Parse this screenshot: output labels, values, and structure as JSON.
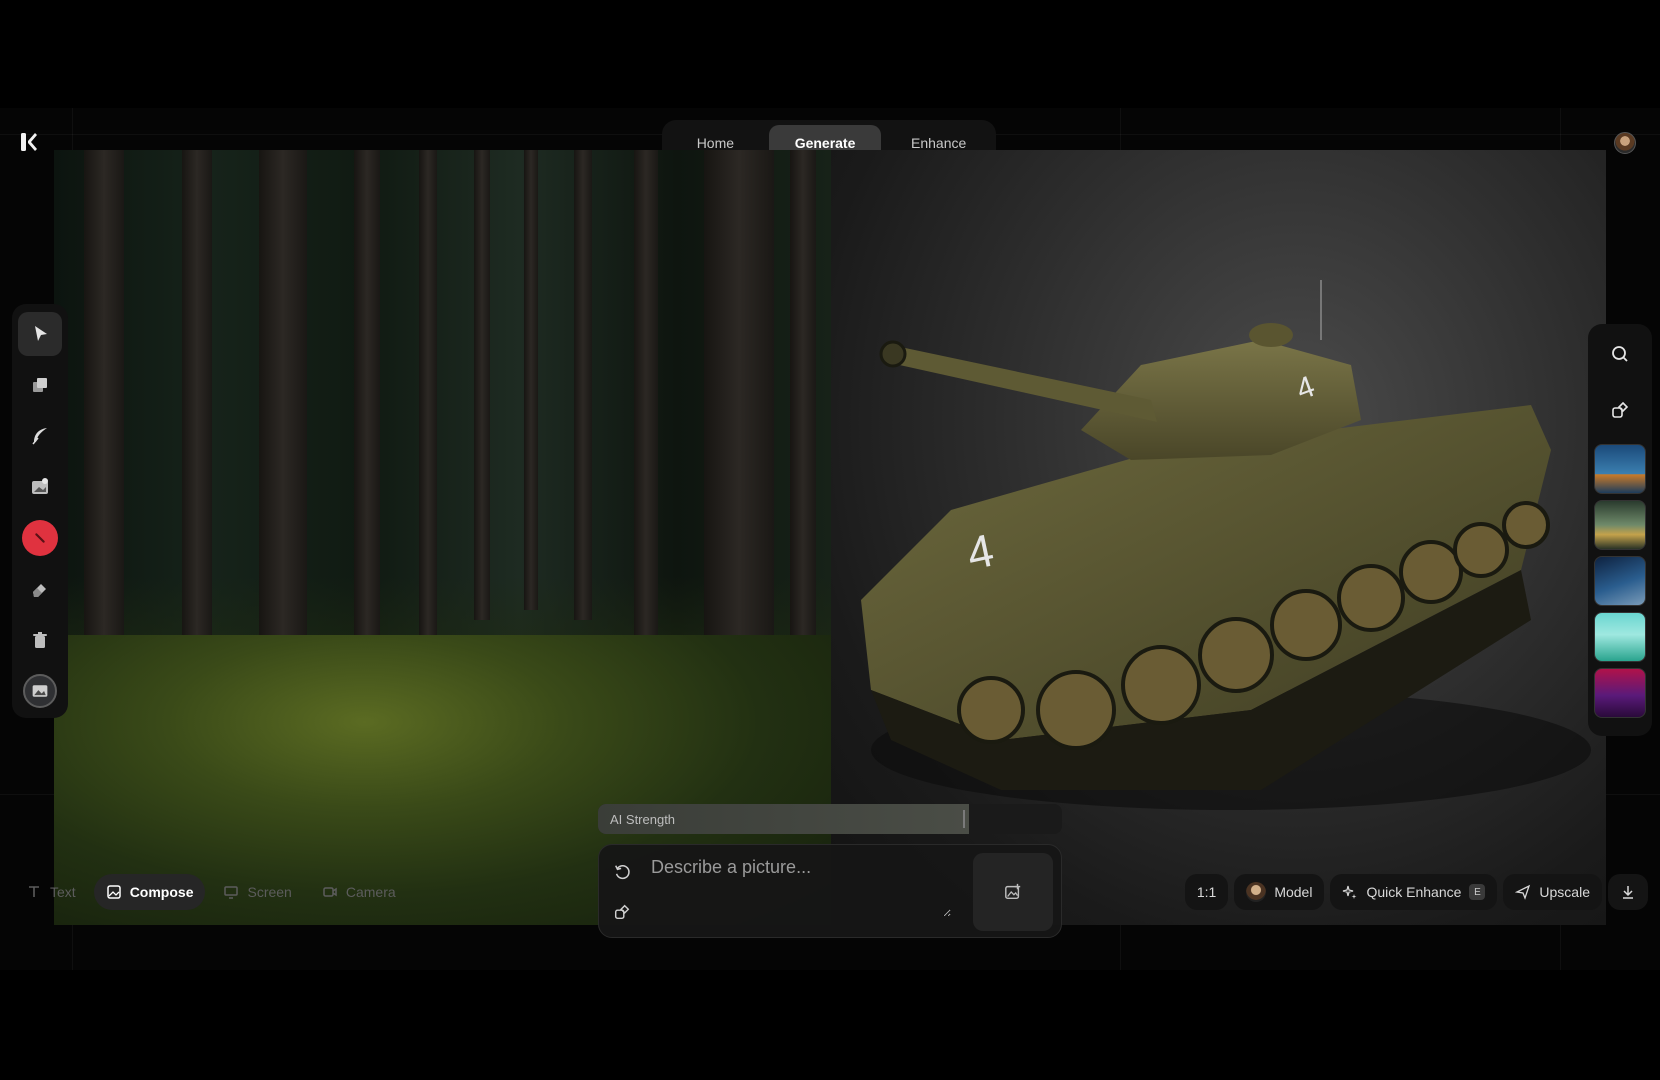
{
  "nav": {
    "home": "Home",
    "generate": "Generate",
    "enhance": "Enhance"
  },
  "strength": {
    "label": "AI Strength",
    "value": 0.8
  },
  "prompt": {
    "placeholder": "Describe a picture..."
  },
  "modes": {
    "text": "Text",
    "compose": "Compose",
    "screen": "Screen",
    "camera": "Camera",
    "active": "compose"
  },
  "actions": {
    "ratio": "1:1",
    "model": "Model",
    "quick_enhance": "Quick Enhance",
    "quick_enhance_key": "E",
    "upscale": "Upscale"
  },
  "tools": [
    "select-tool",
    "layers-tool",
    "brush-tool",
    "image-tool",
    "color-tool",
    "eraser-tool",
    "delete-tool",
    "background-tool"
  ],
  "active_tool": "select-tool",
  "colors": {
    "accent_red": "#e0323f",
    "tab_active": "#3a3a3a",
    "panel": "#111111"
  }
}
